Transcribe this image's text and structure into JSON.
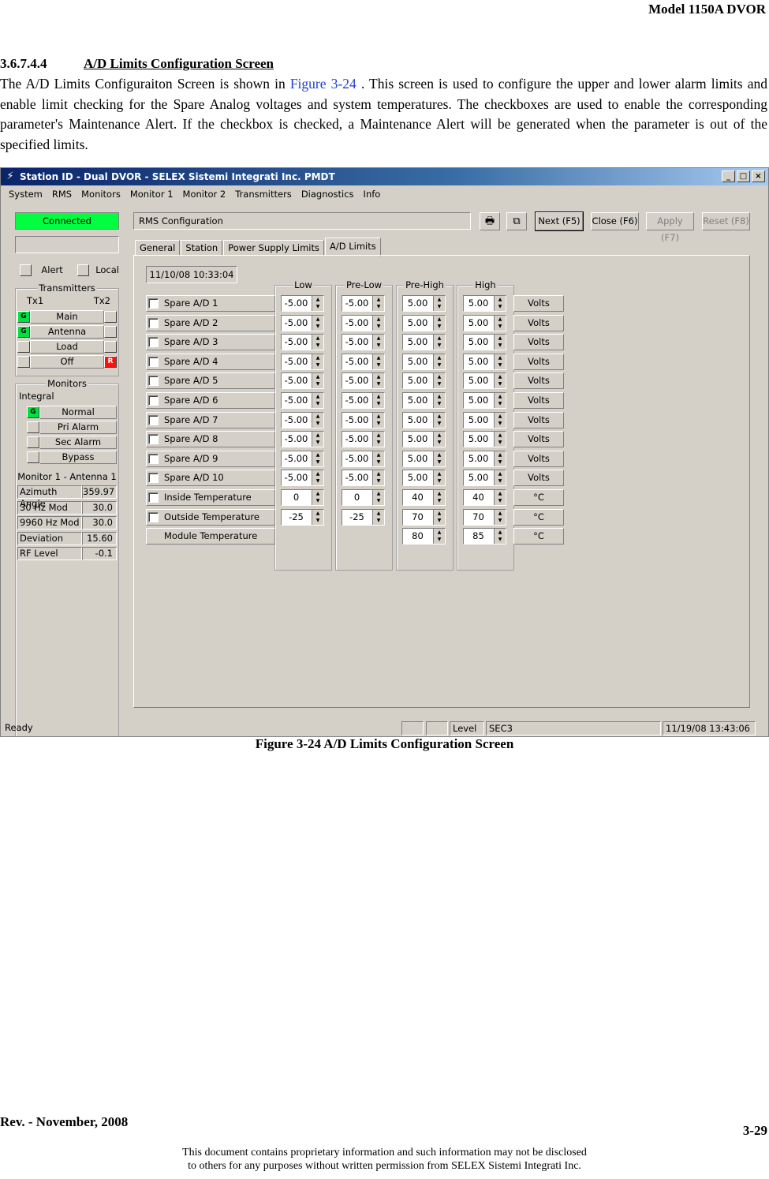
{
  "doc": {
    "header": "Model 1150A DVOR",
    "section_number": "3.6.7.4.4",
    "section_title": "A/D Limits  Configuration Screen",
    "intro_pre": "The A/D Limits Configuraiton Screen is shown in ",
    "intro_ref": "Figure 3-24",
    "intro_post": " .  This screen is used to configure the upper and lower alarm limits and enable limit checking for the Spare Analog voltages and system temperatures. The checkboxes are used to enable the corresponding parameter's Maintenance Alert. If the checkbox is checked, a Maintenance Alert will be generated when the parameter is out of the specified limits.",
    "caption": "Figure 3-24 A/D Limits Configuration Screen",
    "footer_rev": "Rev. -  November, 2008",
    "footer_page": "3-29",
    "footer_note1": "This document contains proprietary information and such information may not be disclosed",
    "footer_note2": "to others for any purposes without written permission from SELEX Sistemi Integrati Inc."
  },
  "window": {
    "title": "Station ID - Dual DVOR - SELEX Sistemi Integrati Inc. PMDT",
    "menu": [
      "System",
      "RMS",
      "Monitors",
      "Monitor 1",
      "Monitor 2",
      "Transmitters",
      "Diagnostics",
      "Info"
    ]
  },
  "left": {
    "connected": "Connected",
    "alert": "Alert",
    "local": "Local",
    "transmitters_title": "Transmitters",
    "tx1": "Tx1",
    "tx2": "Tx2",
    "tx_rows": [
      "Main",
      "Antenna",
      "Load",
      "Off"
    ],
    "g": "G",
    "r": "R",
    "monitors_title": "Monitors",
    "integral": "Integral",
    "mon_rows": [
      "Normal",
      "Pri Alarm",
      "Sec Alarm",
      "Bypass"
    ],
    "monitor_heading": "Monitor 1 - Antenna 1",
    "measurements": [
      {
        "label": "Azimuth Angle",
        "value": "359.97"
      },
      {
        "label": "30 Hz Mod",
        "value": "30.0"
      },
      {
        "label": "9960 Hz Mod",
        "value": "30.0"
      },
      {
        "label": "Deviation",
        "value": "15.60"
      },
      {
        "label": "RF Level",
        "value": "-0.1"
      }
    ]
  },
  "main": {
    "rms_title": "RMS Configuration",
    "next_btn": "Next (F5)",
    "close_btn": "Close (F6)",
    "apply_btn": "Apply (F7)",
    "reset_btn": "Reset (F8)",
    "tabs": [
      "General",
      "Station",
      "Power Supply Limits",
      "A/D Limits"
    ],
    "date": "11/10/08 10:33:04",
    "columns": [
      "Low",
      "Pre-Low",
      "Pre-High",
      "High"
    ],
    "rows": [
      {
        "label": "Spare A/D 1",
        "low": "-5.00",
        "prelow": "-5.00",
        "prehigh": "5.00",
        "high": "5.00",
        "unit": "Volts"
      },
      {
        "label": "Spare A/D 2",
        "low": "-5.00",
        "prelow": "-5.00",
        "prehigh": "5.00",
        "high": "5.00",
        "unit": "Volts"
      },
      {
        "label": "Spare A/D 3",
        "low": "-5.00",
        "prelow": "-5.00",
        "prehigh": "5.00",
        "high": "5.00",
        "unit": "Volts"
      },
      {
        "label": "Spare A/D 4",
        "low": "-5.00",
        "prelow": "-5.00",
        "prehigh": "5.00",
        "high": "5.00",
        "unit": "Volts"
      },
      {
        "label": "Spare A/D 5",
        "low": "-5.00",
        "prelow": "-5.00",
        "prehigh": "5.00",
        "high": "5.00",
        "unit": "Volts"
      },
      {
        "label": "Spare A/D 6",
        "low": "-5.00",
        "prelow": "-5.00",
        "prehigh": "5.00",
        "high": "5.00",
        "unit": "Volts"
      },
      {
        "label": "Spare A/D 7",
        "low": "-5.00",
        "prelow": "-5.00",
        "prehigh": "5.00",
        "high": "5.00",
        "unit": "Volts"
      },
      {
        "label": "Spare A/D 8",
        "low": "-5.00",
        "prelow": "-5.00",
        "prehigh": "5.00",
        "high": "5.00",
        "unit": "Volts"
      },
      {
        "label": "Spare A/D 9",
        "low": "-5.00",
        "prelow": "-5.00",
        "prehigh": "5.00",
        "high": "5.00",
        "unit": "Volts"
      },
      {
        "label": "Spare A/D 10",
        "low": "-5.00",
        "prelow": "-5.00",
        "prehigh": "5.00",
        "high": "5.00",
        "unit": "Volts"
      },
      {
        "label": "Inside Temperature",
        "low": "0",
        "prelow": "0",
        "prehigh": "40",
        "high": "40",
        "unit": "°C"
      },
      {
        "label": "Outside Temperature",
        "low": "-25",
        "prelow": "-25",
        "prehigh": "70",
        "high": "70",
        "unit": "°C"
      },
      {
        "label": "Module Temperature",
        "prehigh": "80",
        "high": "85",
        "unit": "°C"
      }
    ]
  },
  "status": {
    "ready": "Ready",
    "level": "Level 3",
    "user": "SEC3",
    "datetime": "11/19/08 13:43:06"
  }
}
